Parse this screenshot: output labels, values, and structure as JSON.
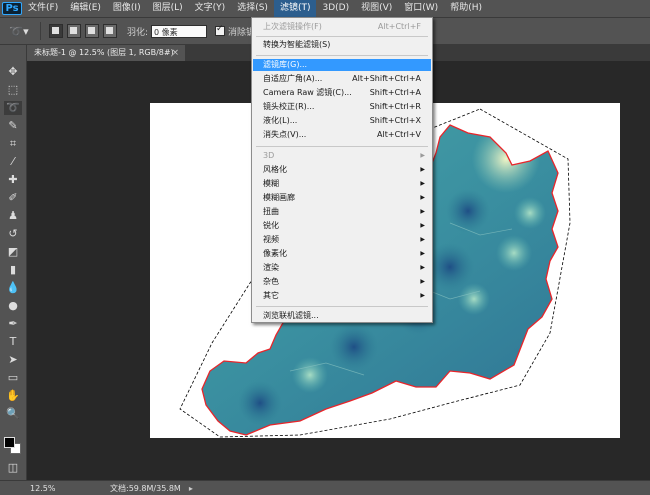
{
  "menubar": {
    "logo": "Ps",
    "items": [
      "文件(F)",
      "编辑(E)",
      "图像(I)",
      "图层(L)",
      "文字(Y)",
      "选择(S)",
      "滤镜(T)",
      "3D(D)",
      "视图(V)",
      "窗口(W)",
      "帮助(H)"
    ],
    "active_index": 6
  },
  "options": {
    "feather_label": "羽化:",
    "feather_value": "0 像素",
    "antialias_label": "消除锯齿"
  },
  "document": {
    "tab_title": "未标题-1 @ 12.5% (图层 1, RGB/8#)",
    "tab_close": "×"
  },
  "status": {
    "zoom": "12.5%",
    "doc_size": "文档:59.8M/35.8M"
  },
  "filter_menu": {
    "last_filter": {
      "label": "上次滤镜操作(F)",
      "shortcut": "Alt+Ctrl+F"
    },
    "smart_filter": "转换为智能滤镜(S)",
    "gallery": "滤镜库(G)...",
    "adaptive_wide": {
      "label": "自适应广角(A)...",
      "shortcut": "Alt+Shift+Ctrl+A"
    },
    "camera_raw": {
      "label": "Camera Raw 滤镜(C)...",
      "shortcut": "Shift+Ctrl+A"
    },
    "lens_correction": {
      "label": "镜头校正(R)...",
      "shortcut": "Shift+Ctrl+R"
    },
    "liquify": {
      "label": "液化(L)...",
      "shortcut": "Shift+Ctrl+X"
    },
    "vanishing_point": {
      "label": "消失点(V)...",
      "shortcut": "Alt+Ctrl+V"
    },
    "submenus": [
      "3D",
      "风格化",
      "模糊",
      "模糊画廊",
      "扭曲",
      "锐化",
      "视频",
      "像素化",
      "渲染",
      "杂色",
      "其它"
    ],
    "browse_online": "浏览联机滤镜..."
  },
  "colors": {
    "menu_active": "#2c5e8e",
    "highlight": "#3399ff",
    "outline": "#e8252a"
  }
}
